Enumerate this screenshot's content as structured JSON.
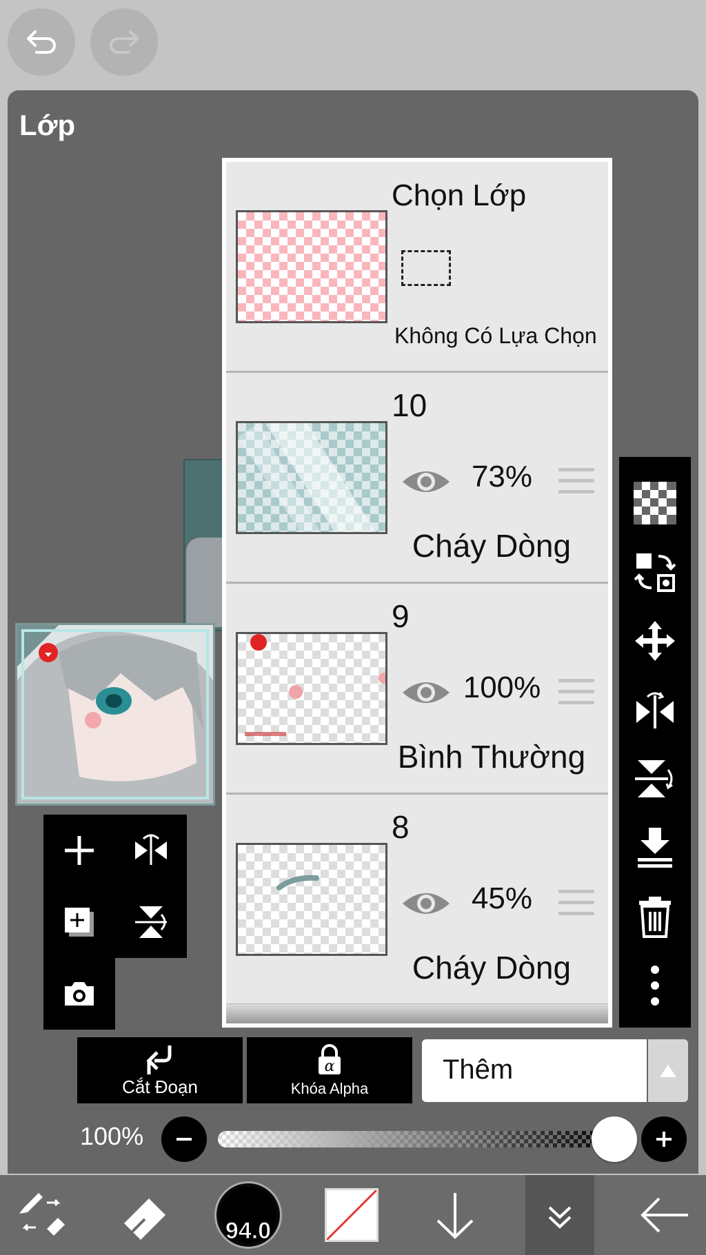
{
  "panel_title": "Lớp",
  "selection_layer": {
    "title": "Chọn Lớp",
    "status": "Không Có Lựa Chọn"
  },
  "layers": [
    {
      "number": "10",
      "opacity": "73%",
      "blend_mode": "Cháy Dòng"
    },
    {
      "number": "9",
      "opacity": "100%",
      "blend_mode": "Bình Thường"
    },
    {
      "number": "8",
      "opacity": "45%",
      "blend_mode": "Cháy Dòng"
    }
  ],
  "actions": {
    "clipping_label": "Cắt Đoạn",
    "alpha_lock_label": "Khóa Alpha"
  },
  "blend_mode_select": {
    "value": "Thêm"
  },
  "opacity_control": {
    "label": "100%",
    "value_percent": 100
  },
  "toolbar": {
    "brush_size": "94.0"
  },
  "icons": {
    "undo": "undo-icon",
    "redo": "redo-icon",
    "add_layer": "plus-icon",
    "flip_h": "flip-horizontal-icon",
    "copy_layer": "duplicate-layer-icon",
    "flip_v": "flip-vertical-icon",
    "camera": "camera-icon",
    "transparency": "checkerboard-icon",
    "swap": "swap-layer-icon",
    "move": "move-icon",
    "merge_down": "merge-down-icon",
    "delete": "trash-icon",
    "more": "more-vertical-icon"
  },
  "colors": {
    "panel": "#666666",
    "toolbar": "#6b6b6b",
    "background": "#c4c4c4",
    "pen_color_slash": "#e53935"
  }
}
